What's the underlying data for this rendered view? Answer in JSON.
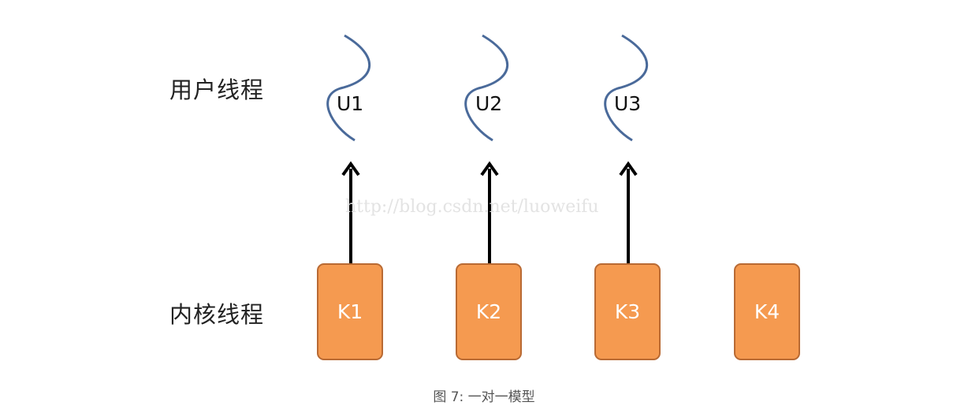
{
  "labels": {
    "user_threads": "用户线程",
    "kernel_threads": "内核线程"
  },
  "user_threads": [
    "U1",
    "U2",
    "U3"
  ],
  "kernel_threads": [
    "K1",
    "K2",
    "K3",
    "K4"
  ],
  "mappings": [
    {
      "kernel": "K1",
      "user": "U1"
    },
    {
      "kernel": "K2",
      "user": "U2"
    },
    {
      "kernel": "K3",
      "user": "U3"
    }
  ],
  "watermark": "http://blog.csdn.net/luoweifu",
  "caption": "图 7: 一对一模型",
  "colors": {
    "kernel_fill": "#f59a50",
    "kernel_border": "#b96a33",
    "wave_stroke": "#4a6a9a",
    "arrow": "#000000"
  }
}
